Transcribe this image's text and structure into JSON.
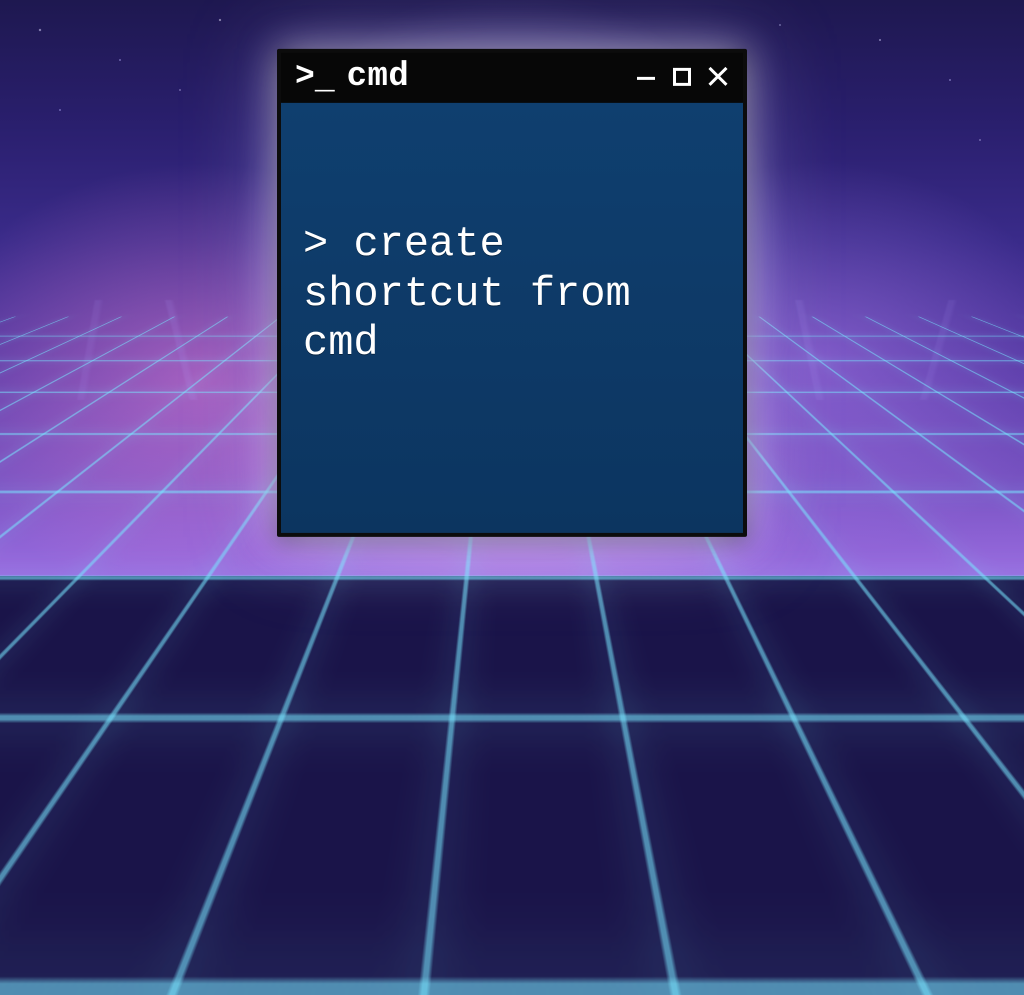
{
  "window": {
    "title": "cmd",
    "icon": "terminal-icon"
  },
  "controls": {
    "minimize": "Minimize",
    "maximize": "Maximize",
    "close": "Close"
  },
  "terminal": {
    "prompt_symbol": ">",
    "command": "create shortcut from cmd"
  },
  "colors": {
    "terminal_bg": "#0d3a66",
    "titlebar_bg": "#070707",
    "text": "#ffffff"
  }
}
